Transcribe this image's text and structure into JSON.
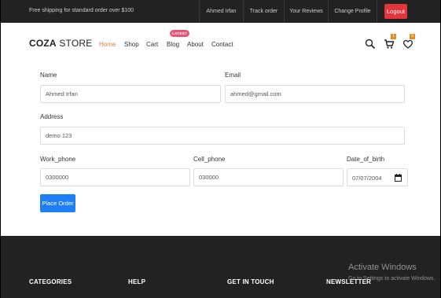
{
  "topbar": {
    "shipping_text": "Free shipping for standard order over $100",
    "links": [
      "Ahmed Irfan",
      "Track order",
      "Your Reviews",
      "Change Profile"
    ],
    "logout_label": "Logout"
  },
  "header": {
    "logo_bold": "COZA",
    "logo_light": " STORE",
    "nav": [
      "Home",
      "Shop",
      "Cart",
      "Blog",
      "About",
      "Contact"
    ],
    "active_nav": "Home",
    "blog_badge": "LATEST",
    "cart_count": "1",
    "wishlist_count": "0",
    "icons": [
      "search-icon",
      "cart-icon",
      "heart-icon"
    ]
  },
  "form": {
    "name_label": "Name",
    "name_value": "Ahmed Irfan",
    "email_label": "Email",
    "email_value": "ahmed@gmail.com",
    "address_label": "Address",
    "address_value": "demo 123",
    "work_phone_label": "Work_phone",
    "work_phone_value": "0300000",
    "cell_phone_label": "Cell_phone",
    "cell_phone_value": "030000",
    "dob_label": "Date_of_birth",
    "dob_value": "07/07/2004",
    "submit_label": "Place Order"
  },
  "footer": {
    "headings": [
      "CATEGORIES",
      "HELP",
      "GET IN TOUCH",
      "NEWSLETTER"
    ]
  },
  "watermark": {
    "title": "Activate Windows",
    "subtitle": "Go to Settings to activate Windows."
  },
  "colors": {
    "accent": "#e07d3c",
    "logout": "#e4353f",
    "primary_button": "#1e7ef5",
    "dark": "#222222"
  }
}
